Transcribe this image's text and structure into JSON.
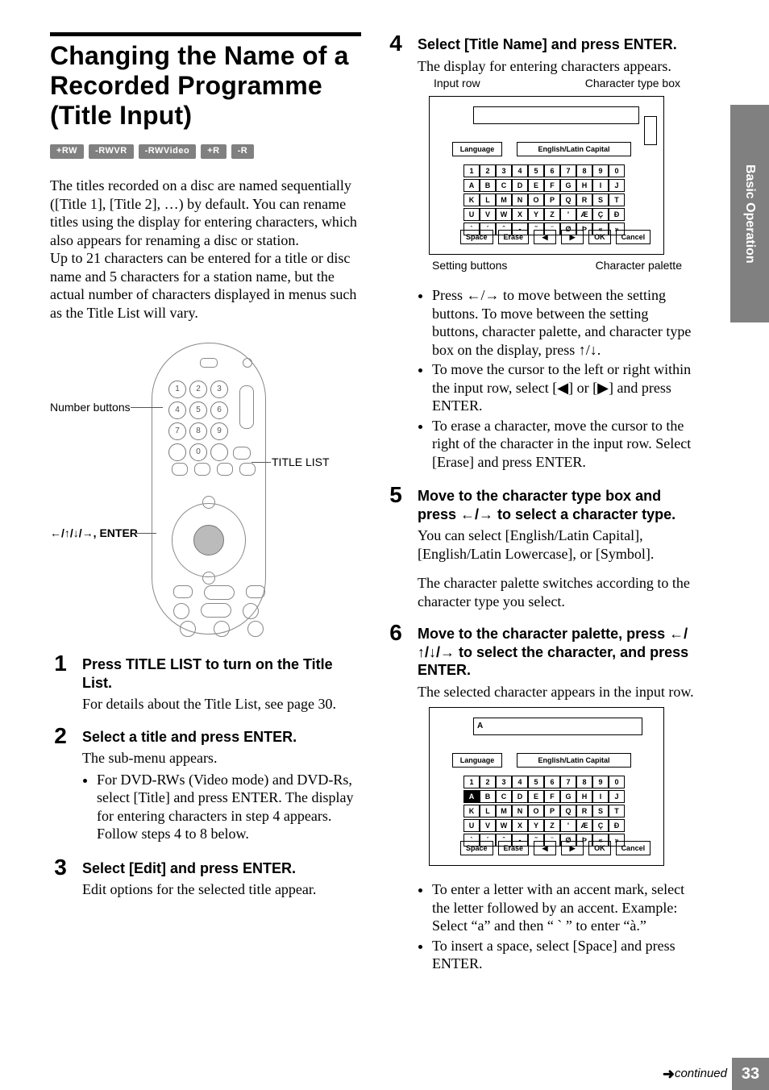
{
  "side_tab": "Basic Operation",
  "page_number": "33",
  "continued": "continued",
  "heading": "Changing the Name of a Recorded Programme (Title Input)",
  "badges": [
    "+RW",
    "-RWVR",
    "-RWVideo",
    "+R",
    "-R"
  ],
  "intro_p1": "The titles recorded on a disc are named sequentially ([Title 1], [Title 2], …) by default. You can rename titles using the display for entering characters, which also appears for renaming a disc or station.",
  "intro_p2": "Up to 21 characters can be entered for a title or disc name and 5 characters for a station name, but the actual number of characters displayed in menus such as the Title List will vary.",
  "remote_labels": {
    "numbers": "Number buttons",
    "title_list": "TITLE LIST",
    "dpad": "←/↑/↓/→, ENTER"
  },
  "steps_left": [
    {
      "num": "1",
      "headline": "Press TITLE LIST to turn on the Title List.",
      "body": "For details about the Title List, see page 30."
    },
    {
      "num": "2",
      "headline": "Select a title and press ENTER.",
      "body": "The sub-menu appears.",
      "bullets": [
        "For DVD-RWs (Video mode) and DVD-Rs, select [Title] and press ENTER. The display for entering characters in step 4 appears. Follow steps 4 to 8 below."
      ]
    },
    {
      "num": "3",
      "headline": "Select [Edit] and press ENTER.",
      "body": "Edit options for the selected title appear."
    }
  ],
  "steps_right": [
    {
      "num": "4",
      "headline": "Select [Title Name] and press ENTER.",
      "body": "The display for entering characters appears.",
      "figure1": true,
      "bullets": [
        "Press ←/→ to move between the setting buttons. To move between the setting buttons, character palette, and character type box on the display, press ↑/↓.",
        "To move the cursor to the left or right within the input row, select [◀] or [▶] and press ENTER.",
        "To erase a character, move the cursor to the right of the character in the input row. Select [Erase] and press ENTER."
      ]
    },
    {
      "num": "5",
      "headline": "Move to the character type box and press ←/→ to select a character type.",
      "body": "You can select [English/Latin Capital], [English/Latin Lowercase], or [Symbol].",
      "body2": "The character palette switches according to the character type you select."
    },
    {
      "num": "6",
      "headline": "Move to the character palette, press ←/↑/↓/→ to select the character, and press ENTER.",
      "body": "The selected character appears in the input row.",
      "figure2": true,
      "bullets": [
        "To enter a letter with an accent mark, select the letter followed by an accent. Example: Select “a” and then “ ` ” to enter “à.”",
        "To insert a space, select [Space] and press ENTER."
      ]
    }
  ],
  "fig": {
    "input_row_label": "Input row",
    "char_type_label": "Character type box",
    "setting_buttons_label": "Setting buttons",
    "char_palette_label": "Character palette",
    "language": "Language",
    "char_type": "English/Latin Capital",
    "row1": [
      "1",
      "2",
      "3",
      "4",
      "5",
      "6",
      "7",
      "8",
      "9",
      "0"
    ],
    "row2": [
      "A",
      "B",
      "C",
      "D",
      "E",
      "F",
      "G",
      "H",
      "I",
      "J"
    ],
    "row3": [
      "K",
      "L",
      "M",
      "N",
      "O",
      "P",
      "Q",
      "R",
      "S",
      "T"
    ],
    "row4": [
      "U",
      "V",
      "W",
      "X",
      "Y",
      "Z",
      "'",
      "Æ",
      "Ç",
      "Ð"
    ],
    "row5": [
      "`",
      "´",
      "ˆ",
      "-",
      "˜",
      "¨",
      "Ø",
      "Þ",
      "«",
      "»"
    ],
    "btn_space": "Space",
    "btn_erase": "Erase",
    "btn_ok": "OK",
    "btn_cancel": "Cancel",
    "input_value_fig2": "A"
  }
}
